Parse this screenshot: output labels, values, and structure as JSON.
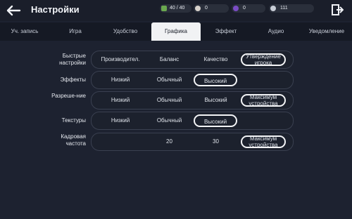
{
  "header": {
    "title": "Настройки",
    "stamina": "40 / 40",
    "res_a": "0",
    "res_b": "0",
    "res_c": "111"
  },
  "tabs": [
    {
      "label": "Уч. запись"
    },
    {
      "label": "Игра"
    },
    {
      "label": "Удобство"
    },
    {
      "label": "Графика"
    },
    {
      "label": "Эффект"
    },
    {
      "label": "Аудио"
    },
    {
      "label": "Уведомление"
    }
  ],
  "settings": {
    "quick": {
      "label": "Быстрые настройки",
      "options": [
        "Производител.",
        "Баланс",
        "Качество",
        "Утверждение игрока"
      ],
      "selected": "Утверждение игрока"
    },
    "effects": {
      "label": "Эффекты",
      "options": [
        "Низкий",
        "Обычный",
        "Высокий"
      ],
      "selected": "Высокий"
    },
    "resolution": {
      "label": "Разреше-ние",
      "options": [
        "Низкий",
        "Обычный",
        "Высокий",
        "Максимум устройства"
      ],
      "selected": "Максимум устройства"
    },
    "textures": {
      "label": "Текстуры",
      "options": [
        "Низкий",
        "Обычный",
        "Высокий"
      ],
      "selected": "Высокий"
    },
    "framerate": {
      "label": "Кадровая частота",
      "options": [
        "20",
        "30",
        "Максимум устройства"
      ],
      "selected": "Максимум устройства"
    }
  },
  "colors": {
    "background": "#1d2230",
    "active_tab": "#f1f2f4",
    "selected_border": "#f3f4f6"
  }
}
